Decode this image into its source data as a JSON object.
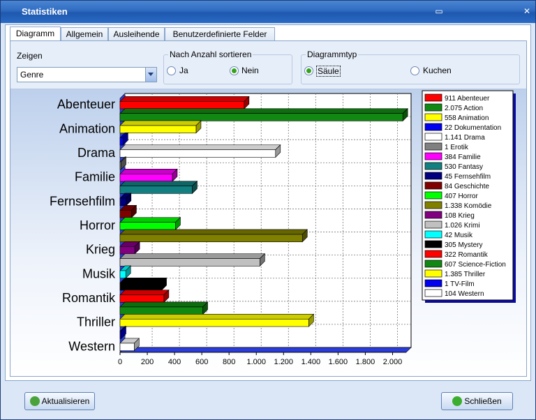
{
  "window": {
    "title": "Statistiken"
  },
  "tabs": [
    "Diagramm",
    "Allgemein",
    "Ausleihende",
    "Benutzerdefinierte Felder"
  ],
  "options": {
    "zeigen_label": "Zeigen",
    "zeigen_value": "Genre",
    "sort_label": "Nach Anzahl sortieren",
    "sort_yes": "Ja",
    "sort_no": "Nein",
    "diagramtype_label": "Diagrammtyp",
    "type_bar": "Säule",
    "type_pie": "Kuchen"
  },
  "buttons": {
    "refresh": "Aktualisieren",
    "close": "Schließen"
  },
  "chart_data": {
    "type": "bar",
    "orientation": "horizontal",
    "categories": [
      "Abenteuer",
      "Action",
      "Animation",
      "Dokumentation",
      "Drama",
      "Erotik",
      "Familie",
      "Fantasy",
      "Fernsehfilm",
      "Geschichte",
      "Horror",
      "Komödie",
      "Krieg",
      "Krimi",
      "Musik",
      "Mystery",
      "Romantik",
      "Science-Fiction",
      "Thriller",
      "TV-Film",
      "Western"
    ],
    "values": [
      911,
      2075,
      558,
      22,
      1141,
      1,
      384,
      530,
      45,
      84,
      407,
      1338,
      108,
      1026,
      42,
      305,
      322,
      607,
      1385,
      1,
      104
    ],
    "colors": [
      "#ff0000",
      "#118811",
      "#ffff00",
      "#0000ee",
      "#ffffff",
      "#808080",
      "#ff00ff",
      "#128080",
      "#000080",
      "#800000",
      "#00ff00",
      "#808000",
      "#800080",
      "#c0c0c0",
      "#00ffff",
      "#000000",
      "#ff0000",
      "#118811",
      "#ffff00",
      "#0000ee",
      "#ffffff"
    ],
    "axis_labels": [
      "Abenteuer",
      "Animation",
      "Drama",
      "Familie",
      "Fernsehfilm",
      "Horror",
      "Krieg",
      "Musik",
      "Romantik",
      "Thriller",
      "Western"
    ],
    "xticks": [
      "0",
      "200",
      "400",
      "600",
      "800",
      "1.000",
      "1.200",
      "1.400",
      "1.600",
      "1.800",
      "2.000"
    ],
    "xlim": [
      0,
      2100
    ],
    "legend": [
      "911 Abenteuer",
      "2.075 Action",
      "558 Animation",
      "22 Dokumentation",
      "1.141 Drama",
      "1 Erotik",
      "384 Familie",
      "530 Fantasy",
      "45 Fernsehfilm",
      "84 Geschichte",
      "407 Horror",
      "1.338 Komödie",
      "108 Krieg",
      "1.026 Krimi",
      "42 Musik",
      "305 Mystery",
      "322 Romantik",
      "607 Science-Fiction",
      "1.385 Thriller",
      "1 TV-Film",
      "104 Western"
    ],
    "grid": true,
    "legend_position": "right"
  }
}
